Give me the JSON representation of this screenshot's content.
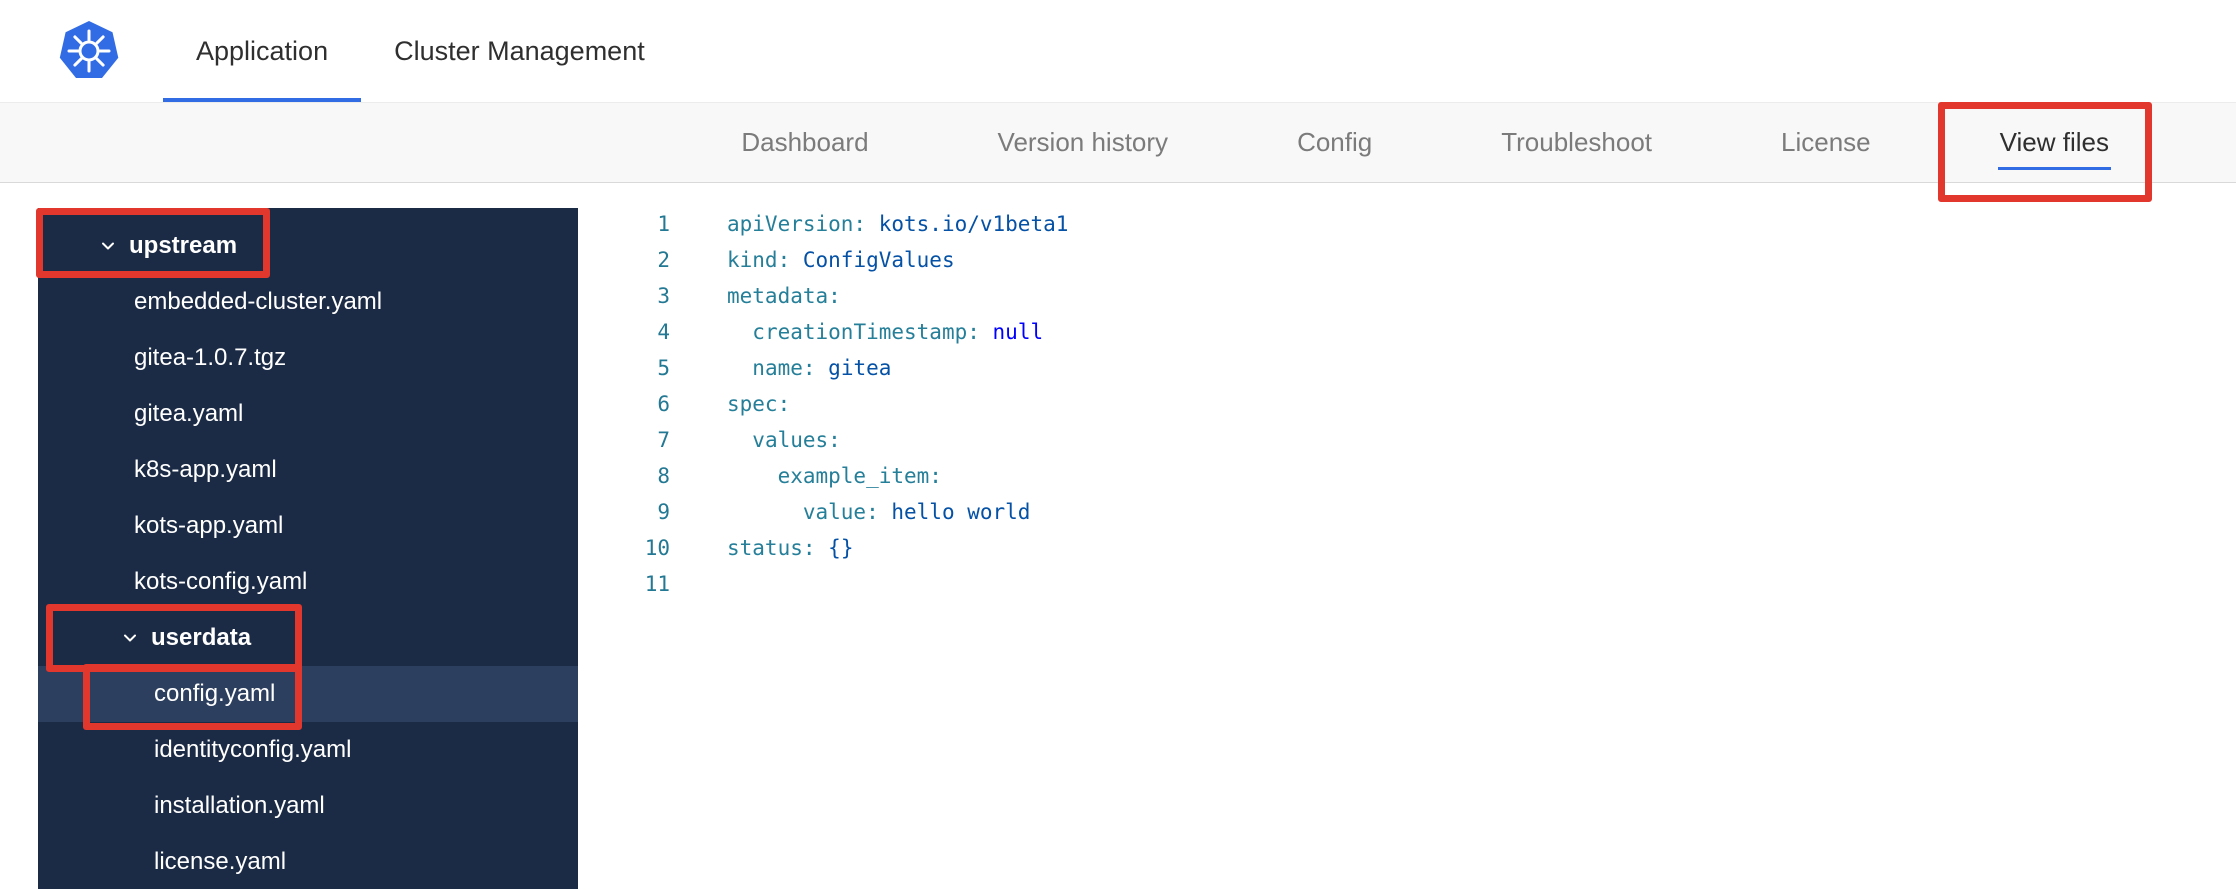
{
  "colors": {
    "accent_blue": "#326ce5",
    "annotation_red": "#e1372d",
    "sidebar_bg": "#1c2b45",
    "sidebar_selected_bg": "#2d3f5e"
  },
  "topnav": {
    "logo_icon": "kubernetes-logo",
    "tabs": [
      {
        "label": "Application",
        "active": true
      },
      {
        "label": "Cluster Management",
        "active": false
      }
    ]
  },
  "subnav": {
    "tabs": [
      {
        "label": "Dashboard",
        "active": false
      },
      {
        "label": "Version history",
        "active": false
      },
      {
        "label": "Config",
        "active": false
      },
      {
        "label": "Troubleshoot",
        "active": false
      },
      {
        "label": "License",
        "active": false
      },
      {
        "label": "View files",
        "active": true,
        "annotated": true
      }
    ]
  },
  "file_tree": [
    {
      "kind": "dir",
      "label": "upstream",
      "depth": 0,
      "expanded": true,
      "annotated": true
    },
    {
      "kind": "file",
      "label": "embedded-cluster.yaml",
      "depth": 1
    },
    {
      "kind": "file",
      "label": "gitea-1.0.7.tgz",
      "depth": 1
    },
    {
      "kind": "file",
      "label": "gitea.yaml",
      "depth": 1
    },
    {
      "kind": "file",
      "label": "k8s-app.yaml",
      "depth": 1
    },
    {
      "kind": "file",
      "label": "kots-app.yaml",
      "depth": 1
    },
    {
      "kind": "file",
      "label": "kots-config.yaml",
      "depth": 1
    },
    {
      "kind": "dir",
      "label": "userdata",
      "depth": 1,
      "expanded": true,
      "annotated": true
    },
    {
      "kind": "file",
      "label": "config.yaml",
      "depth": 2,
      "selected": true,
      "annotated": true
    },
    {
      "kind": "file",
      "label": "identityconfig.yaml",
      "depth": 2
    },
    {
      "kind": "file",
      "label": "installation.yaml",
      "depth": 2
    },
    {
      "kind": "file",
      "label": "license.yaml",
      "depth": 2
    }
  ],
  "editor": {
    "language": "yaml",
    "lines": [
      {
        "num": 1,
        "segments": [
          {
            "text": "apiVersion:",
            "style": "key"
          },
          {
            "text": " ",
            "style": "plain"
          },
          {
            "text": "kots.io/v1beta1",
            "style": "value"
          }
        ]
      },
      {
        "num": 2,
        "segments": [
          {
            "text": "kind:",
            "style": "key"
          },
          {
            "text": " ",
            "style": "plain"
          },
          {
            "text": "ConfigValues",
            "style": "value"
          }
        ]
      },
      {
        "num": 3,
        "segments": [
          {
            "text": "metadata:",
            "style": "key"
          }
        ]
      },
      {
        "num": 4,
        "segments": [
          {
            "text": "  ",
            "style": "plain"
          },
          {
            "text": "creationTimestamp:",
            "style": "key"
          },
          {
            "text": " ",
            "style": "plain"
          },
          {
            "text": "null",
            "style": "keyword"
          }
        ]
      },
      {
        "num": 5,
        "segments": [
          {
            "text": "  ",
            "style": "plain"
          },
          {
            "text": "name:",
            "style": "key"
          },
          {
            "text": " ",
            "style": "plain"
          },
          {
            "text": "gitea",
            "style": "value"
          }
        ]
      },
      {
        "num": 6,
        "segments": [
          {
            "text": "spec:",
            "style": "key"
          }
        ]
      },
      {
        "num": 7,
        "segments": [
          {
            "text": "  ",
            "style": "plain"
          },
          {
            "text": "values:",
            "style": "key"
          }
        ]
      },
      {
        "num": 8,
        "segments": [
          {
            "text": "    ",
            "style": "plain"
          },
          {
            "text": "example_item:",
            "style": "key"
          }
        ]
      },
      {
        "num": 9,
        "segments": [
          {
            "text": "      ",
            "style": "plain"
          },
          {
            "text": "value:",
            "style": "key"
          },
          {
            "text": " ",
            "style": "plain"
          },
          {
            "text": "hello world",
            "style": "value"
          }
        ]
      },
      {
        "num": 10,
        "segments": [
          {
            "text": "status:",
            "style": "key"
          },
          {
            "text": " ",
            "style": "plain"
          },
          {
            "text": "{}",
            "style": "bracket"
          }
        ]
      },
      {
        "num": 11,
        "segments": []
      }
    ]
  },
  "annotations": [
    {
      "target": "view-files-tab"
    },
    {
      "target": "upstream-dir"
    },
    {
      "target": "userdata-dir"
    },
    {
      "target": "config-yaml-file"
    }
  ]
}
